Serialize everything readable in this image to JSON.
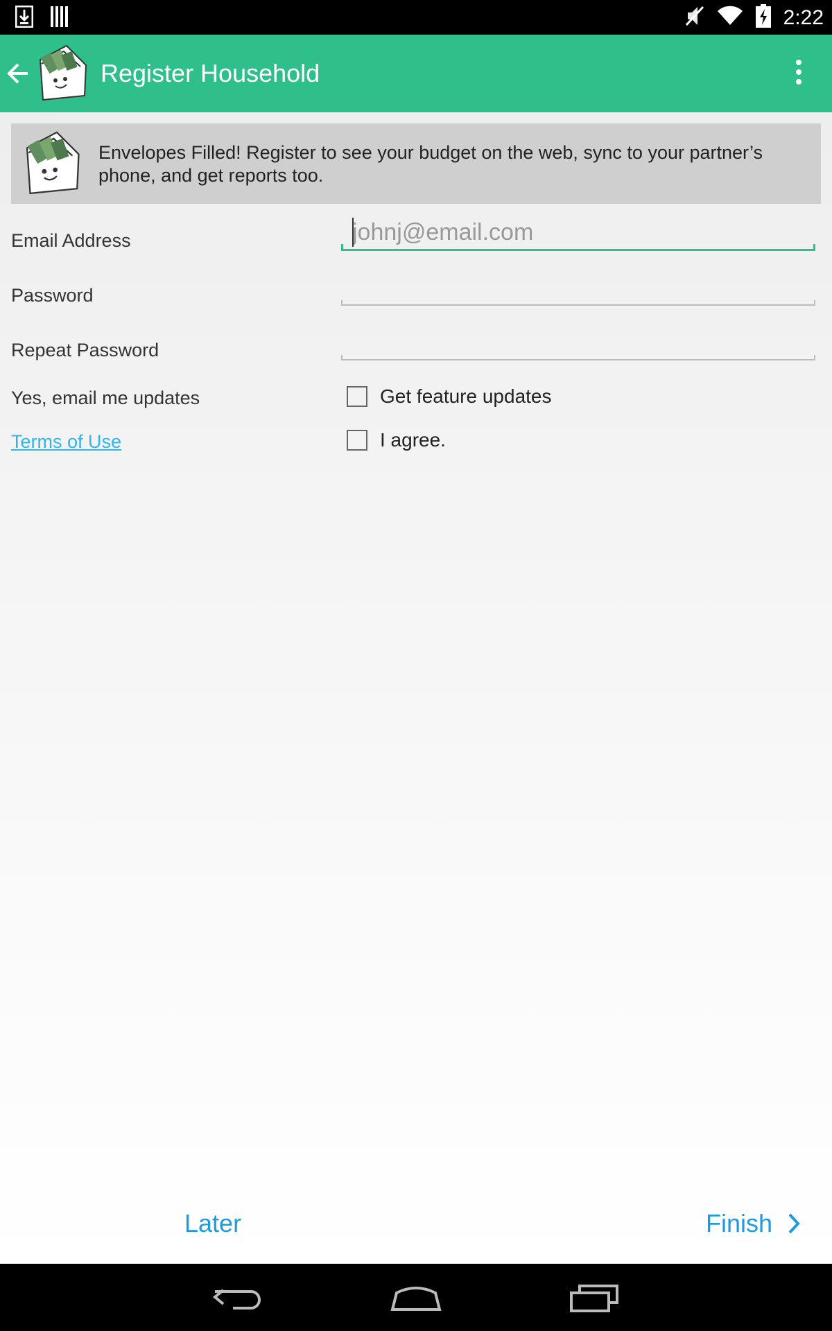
{
  "status_bar": {
    "time": "2:22",
    "left_icons": [
      "download-icon",
      "barcode-icon"
    ],
    "right_icons": [
      "mute-icon",
      "wifi-icon",
      "battery-charging-icon"
    ]
  },
  "action_bar": {
    "title": "Register Household",
    "background_color": "#2ebf8b"
  },
  "banner": {
    "text": "Envelopes Filled! Register to see your budget on the web, sync to your partner’s phone, and get reports too."
  },
  "form": {
    "email": {
      "label": "Email Address",
      "placeholder": "johnj@email.com",
      "value": ""
    },
    "password": {
      "label": "Password",
      "value": ""
    },
    "repeat_password": {
      "label": "Repeat Password",
      "value": ""
    },
    "updates": {
      "label": "Yes, email me updates",
      "checkbox_label": "Get feature updates",
      "checked": false
    },
    "terms": {
      "link_label": "Terms of Use",
      "checkbox_label": "I agree.",
      "checked": false
    }
  },
  "footer": {
    "later_label": "Later",
    "finish_label": "Finish",
    "button_color": "#1e9be0"
  },
  "nav_bar": {
    "buttons": [
      "back-nav-icon",
      "home-nav-icon",
      "recents-nav-icon"
    ]
  }
}
